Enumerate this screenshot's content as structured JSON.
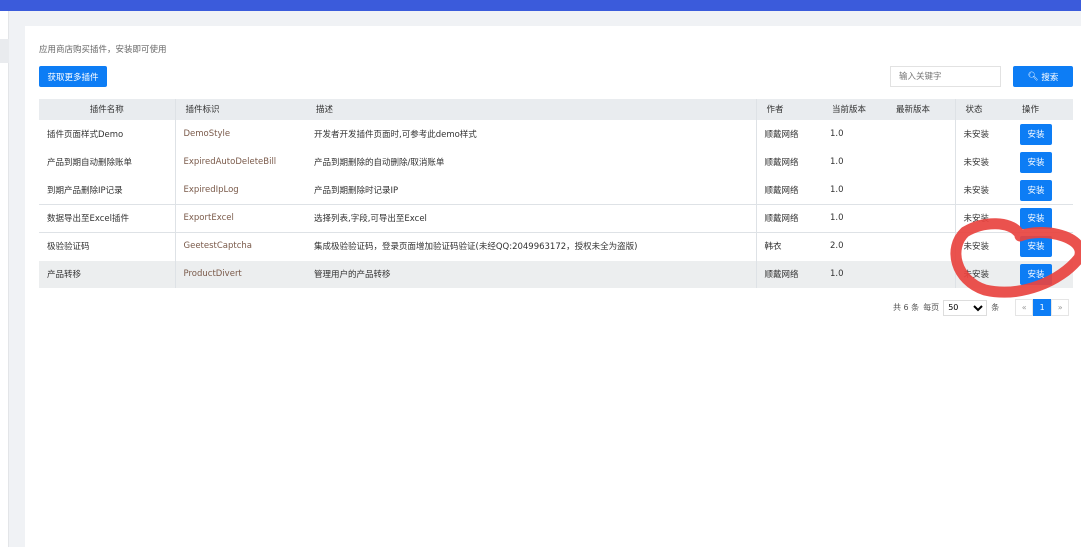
{
  "hint": "应用商店购买插件，安装即可使用",
  "more_button": "获取更多插件",
  "search": {
    "placeholder": "输入关键字",
    "button": "搜索",
    "icon": "search-icon"
  },
  "columns": [
    "插件名称",
    "插件标识",
    "描述",
    "作者",
    "当前版本",
    "最新版本",
    "状态",
    "操作"
  ],
  "rows": [
    {
      "name": "插件页面样式Demo",
      "id": "DemoStyle",
      "desc": "开发者开发插件页面时,可参考此demo样式",
      "author": "顺戴网络",
      "version": "1.0",
      "latest": "",
      "status": "未安装",
      "action": "安装"
    },
    {
      "name": "产品到期自动删除账单",
      "id": "ExpiredAutoDeleteBill",
      "desc": "产品到期删除的自动删除/取消账单",
      "author": "顺戴网络",
      "version": "1.0",
      "latest": "",
      "status": "未安装",
      "action": "安装"
    },
    {
      "name": "到期产品删除IP记录",
      "id": "ExpiredIpLog",
      "desc": "产品到期删除时记录IP",
      "author": "顺戴网络",
      "version": "1.0",
      "latest": "",
      "status": "未安装",
      "action": "安装"
    },
    {
      "name": "数据导出至Excel插件",
      "id": "ExportExcel",
      "desc": "选择列表,字段,可导出至Excel",
      "author": "顺戴网络",
      "version": "1.0",
      "latest": "",
      "status": "未安装",
      "action": "安装"
    },
    {
      "name": "极验验证码",
      "id": "GeetestCaptcha",
      "desc": "集成极验验证码，登录页面增加验证码验证(未经QQ:2049963172，授权未全为盗版)",
      "author": "韩衣",
      "version": "2.0",
      "latest": "",
      "status": "未安装",
      "action": "安装"
    },
    {
      "name": "产品转移",
      "id": "ProductDivert",
      "desc": "管理用户的产品转移",
      "author": "顺戴网络",
      "version": "1.0",
      "latest": "",
      "status": "未安装",
      "action": "安装"
    }
  ],
  "pager": {
    "total": "共 6 条",
    "per_page_label": "每页",
    "per_page": "50",
    "unit": "条",
    "prev": "«",
    "page": "1",
    "next": "»"
  },
  "annotation_color": "#e8433f"
}
